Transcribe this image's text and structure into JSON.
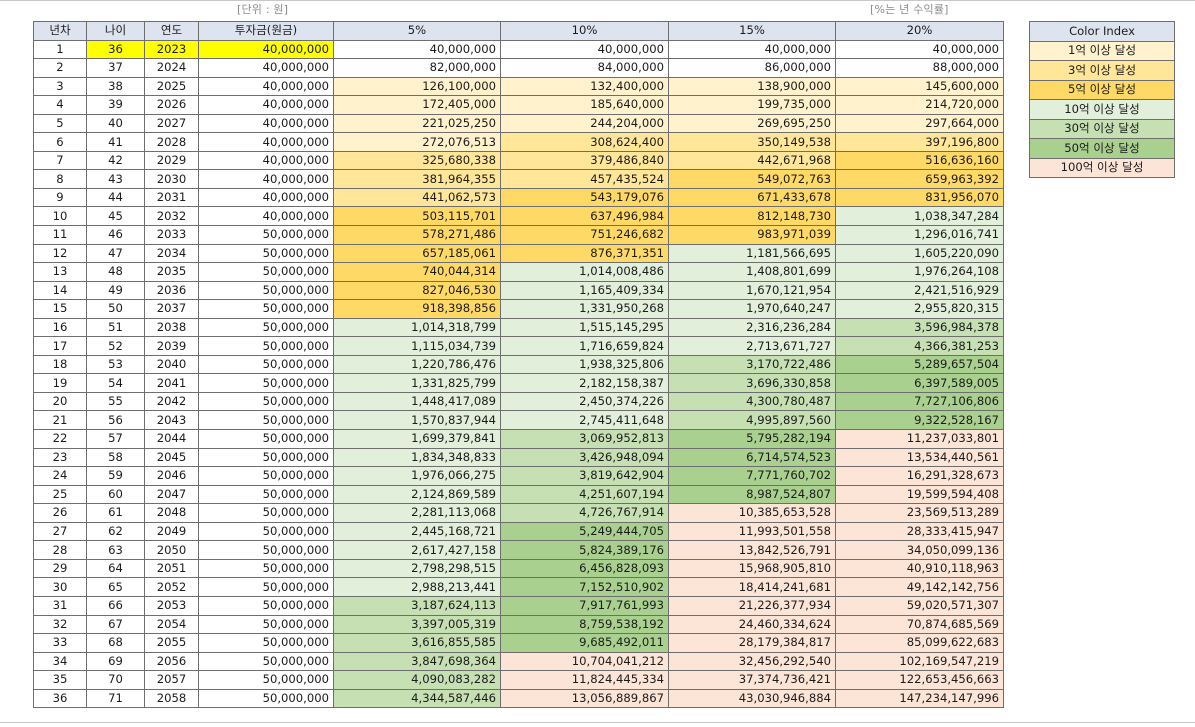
{
  "notes": {
    "unit": "[단위 : 원]",
    "rate": "[%는 년 수익률]"
  },
  "table": {
    "headers": [
      "년차",
      "나이",
      "연도",
      "투자금(원금)",
      "5%",
      "10%",
      "15%",
      "20%"
    ],
    "rows": [
      [
        "1",
        "36",
        "2023",
        "40,000,000",
        "40,000,000",
        "40,000,000",
        "40,000,000",
        "40,000,000"
      ],
      [
        "2",
        "37",
        "2024",
        "40,000,000",
        "82,000,000",
        "84,000,000",
        "86,000,000",
        "88,000,000"
      ],
      [
        "3",
        "38",
        "2025",
        "40,000,000",
        "126,100,000",
        "132,400,000",
        "138,900,000",
        "145,600,000"
      ],
      [
        "4",
        "39",
        "2026",
        "40,000,000",
        "172,405,000",
        "185,640,000",
        "199,735,000",
        "214,720,000"
      ],
      [
        "5",
        "40",
        "2027",
        "40,000,000",
        "221,025,250",
        "244,204,000",
        "269,695,250",
        "297,664,000"
      ],
      [
        "6",
        "41",
        "2028",
        "40,000,000",
        "272,076,513",
        "308,624,400",
        "350,149,538",
        "397,196,800"
      ],
      [
        "7",
        "42",
        "2029",
        "40,000,000",
        "325,680,338",
        "379,486,840",
        "442,671,968",
        "516,636,160"
      ],
      [
        "8",
        "43",
        "2030",
        "40,000,000",
        "381,964,355",
        "457,435,524",
        "549,072,763",
        "659,963,392"
      ],
      [
        "9",
        "44",
        "2031",
        "40,000,000",
        "441,062,573",
        "543,179,076",
        "671,433,678",
        "831,956,070"
      ],
      [
        "10",
        "45",
        "2032",
        "40,000,000",
        "503,115,701",
        "637,496,984",
        "812,148,730",
        "1,038,347,284"
      ],
      [
        "11",
        "46",
        "2033",
        "50,000,000",
        "578,271,486",
        "751,246,682",
        "983,971,039",
        "1,296,016,741"
      ],
      [
        "12",
        "47",
        "2034",
        "50,000,000",
        "657,185,061",
        "876,371,351",
        "1,181,566,695",
        "1,605,220,090"
      ],
      [
        "13",
        "48",
        "2035",
        "50,000,000",
        "740,044,314",
        "1,014,008,486",
        "1,408,801,699",
        "1,976,264,108"
      ],
      [
        "14",
        "49",
        "2036",
        "50,000,000",
        "827,046,530",
        "1,165,409,334",
        "1,670,121,954",
        "2,421,516,929"
      ],
      [
        "15",
        "50",
        "2037",
        "50,000,000",
        "918,398,856",
        "1,331,950,268",
        "1,970,640,247",
        "2,955,820,315"
      ],
      [
        "16",
        "51",
        "2038",
        "50,000,000",
        "1,014,318,799",
        "1,515,145,295",
        "2,316,236,284",
        "3,596,984,378"
      ],
      [
        "17",
        "52",
        "2039",
        "50,000,000",
        "1,115,034,739",
        "1,716,659,824",
        "2,713,671,727",
        "4,366,381,253"
      ],
      [
        "18",
        "53",
        "2040",
        "50,000,000",
        "1,220,786,476",
        "1,938,325,806",
        "3,170,722,486",
        "5,289,657,504"
      ],
      [
        "19",
        "54",
        "2041",
        "50,000,000",
        "1,331,825,799",
        "2,182,158,387",
        "3,696,330,858",
        "6,397,589,005"
      ],
      [
        "20",
        "55",
        "2042",
        "50,000,000",
        "1,448,417,089",
        "2,450,374,226",
        "4,300,780,487",
        "7,727,106,806"
      ],
      [
        "21",
        "56",
        "2043",
        "50,000,000",
        "1,570,837,944",
        "2,745,411,648",
        "4,995,897,560",
        "9,322,528,167"
      ],
      [
        "22",
        "57",
        "2044",
        "50,000,000",
        "1,699,379,841",
        "3,069,952,813",
        "5,795,282,194",
        "11,237,033,801"
      ],
      [
        "23",
        "58",
        "2045",
        "50,000,000",
        "1,834,348,833",
        "3,426,948,094",
        "6,714,574,523",
        "13,534,440,561"
      ],
      [
        "24",
        "59",
        "2046",
        "50,000,000",
        "1,976,066,275",
        "3,819,642,904",
        "7,771,760,702",
        "16,291,328,673"
      ],
      [
        "25",
        "60",
        "2047",
        "50,000,000",
        "2,124,869,589",
        "4,251,607,194",
        "8,987,524,807",
        "19,599,594,408"
      ],
      [
        "26",
        "61",
        "2048",
        "50,000,000",
        "2,281,113,068",
        "4,726,767,914",
        "10,385,653,528",
        "23,569,513,289"
      ],
      [
        "27",
        "62",
        "2049",
        "50,000,000",
        "2,445,168,721",
        "5,249,444,705",
        "11,993,501,558",
        "28,333,415,947"
      ],
      [
        "28",
        "63",
        "2050",
        "50,000,000",
        "2,617,427,158",
        "5,824,389,176",
        "13,842,526,791",
        "34,050,099,136"
      ],
      [
        "29",
        "64",
        "2051",
        "50,000,000",
        "2,798,298,515",
        "6,456,828,093",
        "15,968,905,810",
        "40,910,118,963"
      ],
      [
        "30",
        "65",
        "2052",
        "50,000,000",
        "2,988,213,441",
        "7,152,510,902",
        "18,414,241,681",
        "49,142,142,756"
      ],
      [
        "31",
        "66",
        "2053",
        "50,000,000",
        "3,187,624,113",
        "7,917,761,993",
        "21,226,377,934",
        "59,020,571,307"
      ],
      [
        "32",
        "67",
        "2054",
        "50,000,000",
        "3,397,005,319",
        "8,759,538,192",
        "24,460,334,624",
        "70,874,685,569"
      ],
      [
        "33",
        "68",
        "2055",
        "50,000,000",
        "3,616,855,585",
        "9,685,492,011",
        "28,179,384,817",
        "85,099,622,683"
      ],
      [
        "34",
        "69",
        "2056",
        "50,000,000",
        "3,847,698,364",
        "10,704,041,212",
        "32,456,292,540",
        "102,169,547,219"
      ],
      [
        "35",
        "70",
        "2057",
        "50,000,000",
        "4,090,083,282",
        "11,824,445,334",
        "37,374,736,421",
        "122,653,456,663"
      ],
      [
        "36",
        "71",
        "2058",
        "50,000,000",
        "4,344,587,446",
        "13,056,889,867",
        "43,030,946,884",
        "147,234,147,996"
      ]
    ]
  },
  "legend": {
    "title": "Color Index",
    "items": [
      {
        "label": "1억 이상 달성",
        "color": "#fff2cc"
      },
      {
        "label": "3억 이상 달성",
        "color": "#ffe699"
      },
      {
        "label": "5억 이상 달성",
        "color": "#ffd966"
      },
      {
        "label": "10억 이상 달성",
        "color": "#e2efda"
      },
      {
        "label": "30억 이상 달성",
        "color": "#c6e0b4"
      },
      {
        "label": "50억 이상 달성",
        "color": "#a9d08e"
      },
      {
        "label": "100억 이상 달성",
        "color": "#fce4d6"
      }
    ]
  },
  "colors": {
    "header_bg": "#dde4f0",
    "first_row_highlight": "#ffff00",
    "border": "#6e6e6e"
  }
}
